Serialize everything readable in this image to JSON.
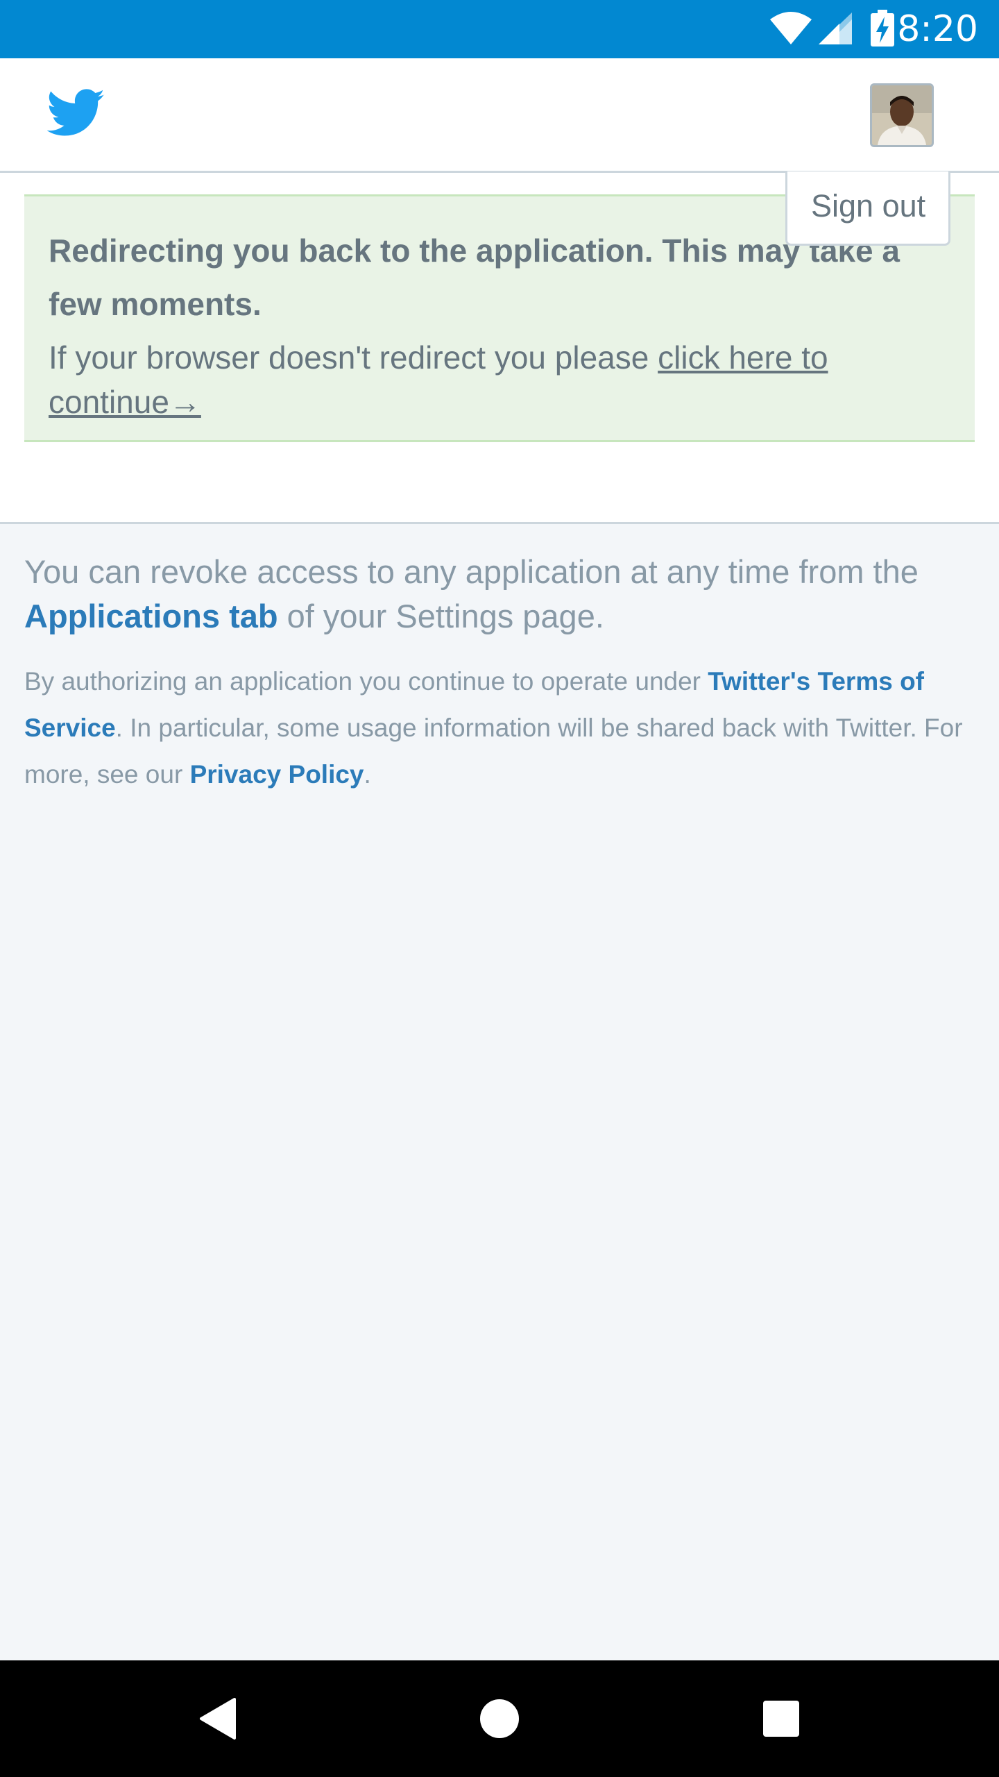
{
  "status_bar": {
    "time": "8:20",
    "icons": [
      "wifi-icon",
      "signal-icon",
      "battery-charging-icon"
    ],
    "background_color": "#0288d1"
  },
  "header": {
    "logo_icon": "twitter-bird-icon",
    "logo_color": "#1da1f2",
    "avatar_icon": "user-avatar"
  },
  "dropdown": {
    "sign_out_label": "Sign out"
  },
  "message": {
    "title": "Redirecting you back to the application. This may take a few moments.",
    "text_before_link": "If your browser doesn't redirect you please ",
    "link_text": "click here to continue→"
  },
  "revoke": {
    "text_before_link": "You can revoke access to any application at any time from the ",
    "link_text": "Applications tab",
    "text_after_link": " of your Settings page."
  },
  "terms": {
    "text_before_terms": "By authorizing an application you continue to operate under ",
    "terms_link": "Twitter's Terms of Service",
    "text_middle": ". In particular, some usage information will be shared back with Twitter. For more, see our ",
    "privacy_link": "Privacy Policy",
    "text_end": "."
  },
  "nav_bar": {
    "icons": [
      "back-icon",
      "home-icon",
      "recents-icon"
    ]
  },
  "colors": {
    "link": "#2b7bb9",
    "message_background": "#e9f3e6",
    "page_background": "#f3f6f9"
  }
}
